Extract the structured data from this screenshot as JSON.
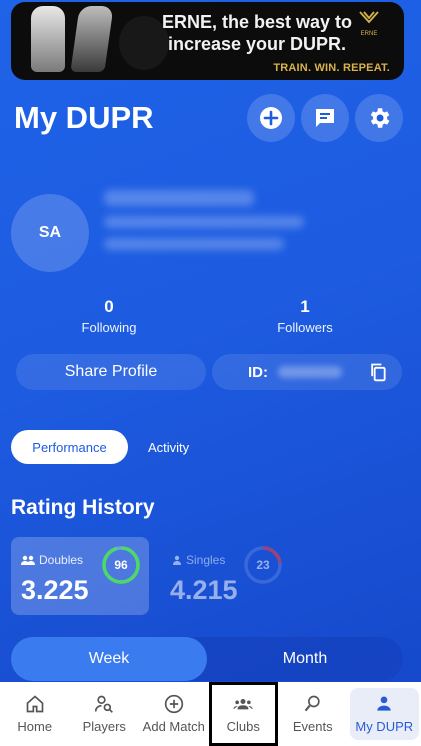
{
  "ad": {
    "headline": "ERNE, the best way to increase your DUPR.",
    "tagline": "TRAIN. WIN. REPEAT.",
    "brand": "ERNE"
  },
  "header": {
    "title": "My DUPR",
    "icons": [
      "add-circle-icon",
      "chat-icon",
      "gear-icon"
    ]
  },
  "profile": {
    "initials": "SA",
    "following_count": "0",
    "following_label": "Following",
    "followers_count": "1",
    "followers_label": "Followers",
    "share_label": "Share Profile",
    "id_label": "ID:"
  },
  "tabs": [
    {
      "label": "Performance",
      "active": true
    },
    {
      "label": "Activity",
      "active": false
    }
  ],
  "rating_history": {
    "title": "Rating History",
    "doubles": {
      "label": "Doubles",
      "value": "3.225",
      "reliability": "96",
      "ring_color": "#4cd964"
    },
    "singles": {
      "label": "Singles",
      "value": "4.215",
      "reliability": "23",
      "ring_color": "#ff3b30"
    }
  },
  "period": {
    "week_label": "Week",
    "month_label": "Month",
    "selected": "Week"
  },
  "nav": [
    {
      "label": "Home",
      "icon": "home-icon"
    },
    {
      "label": "Players",
      "icon": "players-search-icon"
    },
    {
      "label": "Add Match",
      "icon": "add-circle-icon"
    },
    {
      "label": "Clubs",
      "icon": "group-icon"
    },
    {
      "label": "Events",
      "icon": "events-search-icon"
    },
    {
      "label": "My DUPR",
      "icon": "person-icon"
    }
  ],
  "colors": {
    "accent": "#2a5bd7",
    "background": "#1d5be0"
  }
}
